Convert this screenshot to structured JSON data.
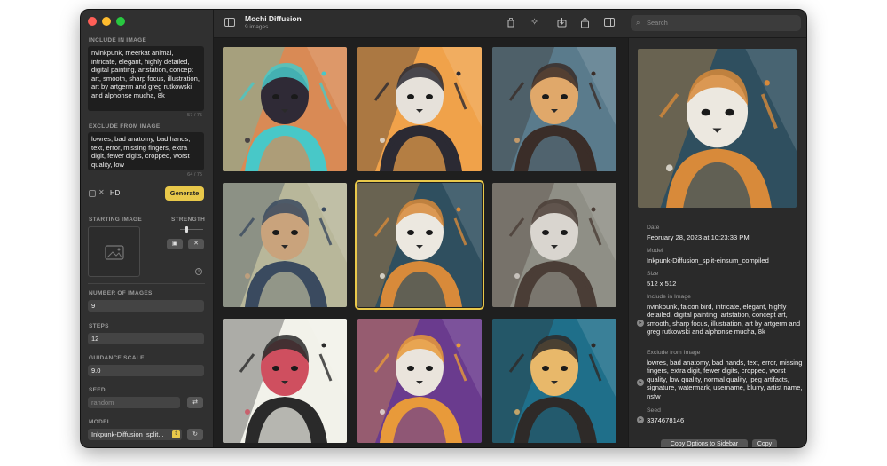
{
  "window": {
    "title": "Mochi Diffusion",
    "subtitle": "9 images",
    "traffic_colors": [
      "#ff5f57",
      "#febc2e",
      "#28c840"
    ]
  },
  "sidebar": {
    "include_label": "INCLUDE IN IMAGE",
    "include_text": "nvinkpunk, meerkat animal, intricate, elegant, highly detailed, digital painting, artstation, concept art, smooth, sharp focus, illustration, art by artgerm and greg rutkowski and alphonse mucha, 8k",
    "include_count": "57 / 75",
    "exclude_label": "EXCLUDE FROM IMAGE",
    "exclude_text": "lowres, bad anatomy, bad hands, text, error, missing fingers, extra digit, fewer digits, cropped, worst quality, low",
    "exclude_count": "64 / 75",
    "hd_label": "HD",
    "generate_label": "Generate",
    "starting_image_label": "STARTING IMAGE",
    "strength_label": "STRENGTH",
    "num_images_label": "NUMBER OF IMAGES",
    "num_images_value": "9",
    "steps_label": "STEPS",
    "steps_value": "12",
    "guidance_label": "GUIDANCE SCALE",
    "guidance_value": "9.0",
    "seed_label": "SEED",
    "seed_placeholder": "random",
    "model_label": "MODEL",
    "model_value": "Inkpunk-Diffusion_split..."
  },
  "toolbar": {
    "search_placeholder": "Search",
    "icons": [
      "sidebar-toggle-icon",
      "trash-icon",
      "magic-wand-icon",
      "download-icon",
      "share-icon",
      "inspector-icon",
      "search-icon"
    ]
  },
  "gallery": {
    "images": [
      {
        "subject": "woman",
        "colors": [
          "#d98a55",
          "#2f2a36",
          "#48c8c8"
        ]
      },
      {
        "subject": "dog",
        "colors": [
          "#f0a24a",
          "#e6e1da",
          "#2b2a33"
        ]
      },
      {
        "subject": "man",
        "colors": [
          "#5a7b8c",
          "#e0a86a",
          "#3a2d28"
        ]
      },
      {
        "subject": "cat",
        "colors": [
          "#b8b79a",
          "#c9a37c",
          "#3a4a5f"
        ]
      },
      {
        "subject": "falcon",
        "colors": [
          "#2f4f5f",
          "#ece8e0",
          "#d88a3a"
        ]
      },
      {
        "subject": "raccoon",
        "colors": [
          "#8f8f86",
          "#d9d5cf",
          "#4a3d36"
        ]
      },
      {
        "subject": "panda",
        "colors": [
          "#f2f2ea",
          "#cf4f5f",
          "#2a2a2a"
        ]
      },
      {
        "subject": "ferret",
        "colors": [
          "#6a3b8e",
          "#eae4dc",
          "#e89a3a"
        ]
      },
      {
        "subject": "meerkat",
        "colors": [
          "#1f6f8a",
          "#e8b86a",
          "#2e2a28"
        ]
      }
    ],
    "selected_index": 4
  },
  "detail": {
    "date_label": "Date",
    "date_value": "February 28, 2023 at 10:23:33 PM",
    "model_label": "Model",
    "model_value": "Inkpunk-Diffusion_split-einsum_compiled",
    "size_label": "Size",
    "size_value": "512 x 512",
    "include_label": "Include in Image",
    "include_value": "nvinkpunk, falcon bird, intricate, elegant, highly detailed, digital painting, artstation, concept art, smooth, sharp focus, illustration, art by artgerm and greg rutkowski and alphonse mucha, 8k",
    "exclude_label": "Exclude from Image",
    "exclude_value": "lowres, bad anatomy, bad hands, text, error, missing fingers, extra digit, fewer digits, cropped, worst quality, low quality, normal quality, jpeg artifacts, signature, watermark, username, blurry, artist name, nsfw",
    "seed_label": "Seed",
    "seed_value": "3374678146",
    "copy_options_label": "Copy Options to Sidebar",
    "copy_label": "Copy"
  }
}
